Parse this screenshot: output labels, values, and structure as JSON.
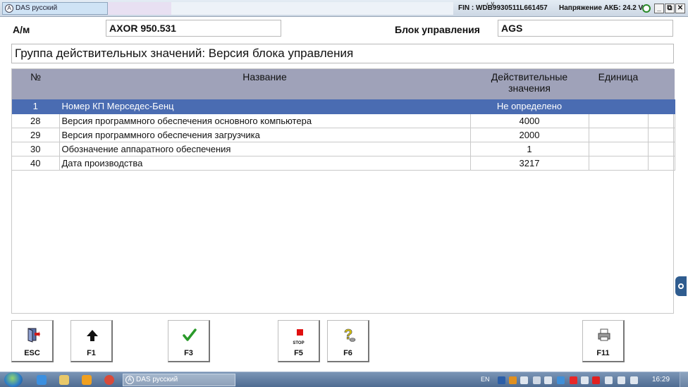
{
  "titlebar": {
    "app_title": "DAS русский",
    "fin_label": "FIN : WDB",
    "fin_value": "9930511L661457",
    "battery_label": "Напряжение АКБ:",
    "battery_value": "24.2 V",
    "minimize": "_",
    "restore": "⧉",
    "close": "✕"
  },
  "header": {
    "vehicle_label": "А/м",
    "vehicle_value": "AXOR 950.531",
    "control_unit_label": "Блок управления",
    "control_unit_value": "AGS",
    "group_title": "Группа действительных значений: Версия блока управления"
  },
  "table": {
    "columns": [
      "№",
      "Название",
      "Действительные значения",
      "Единица"
    ],
    "rows": [
      {
        "num": "1",
        "name": "Номер КП Мерседес-Бенц",
        "value": "Не определено",
        "unit": "",
        "selected": true
      },
      {
        "num": "28",
        "name": "Версия программного обеспечения основного компьютера",
        "value": "4000",
        "unit": ""
      },
      {
        "num": "29",
        "name": "Версия программного обеспечения загрузчика",
        "value": "2000",
        "unit": ""
      },
      {
        "num": "30",
        "name": "Обозначение аппаратного обеспечения",
        "value": "1",
        "unit": ""
      },
      {
        "num": "40",
        "name": "Дата производства",
        "value": "3217",
        "unit": ""
      }
    ]
  },
  "function_keys": [
    {
      "key": "ESC",
      "icon": "exit-door-icon"
    },
    {
      "key": "F1",
      "icon": "arrow-up-icon"
    },
    {
      "key": "F3",
      "icon": "checkmark-icon"
    },
    {
      "key": "F5",
      "icon": "stop-icon",
      "icon_text": "STOP"
    },
    {
      "key": "F6",
      "icon": "help-question-icon"
    },
    {
      "key": "F11",
      "icon": "printer-icon"
    }
  ],
  "taskbar": {
    "task_label": "DAS русский",
    "language": "EN",
    "clock": "16:29"
  },
  "colors": {
    "table_header_bg": "#9fa2b9",
    "selected_row_bg": "#4a6cb2",
    "checkmark": "#2a9a2a",
    "stop": "#e01010"
  }
}
